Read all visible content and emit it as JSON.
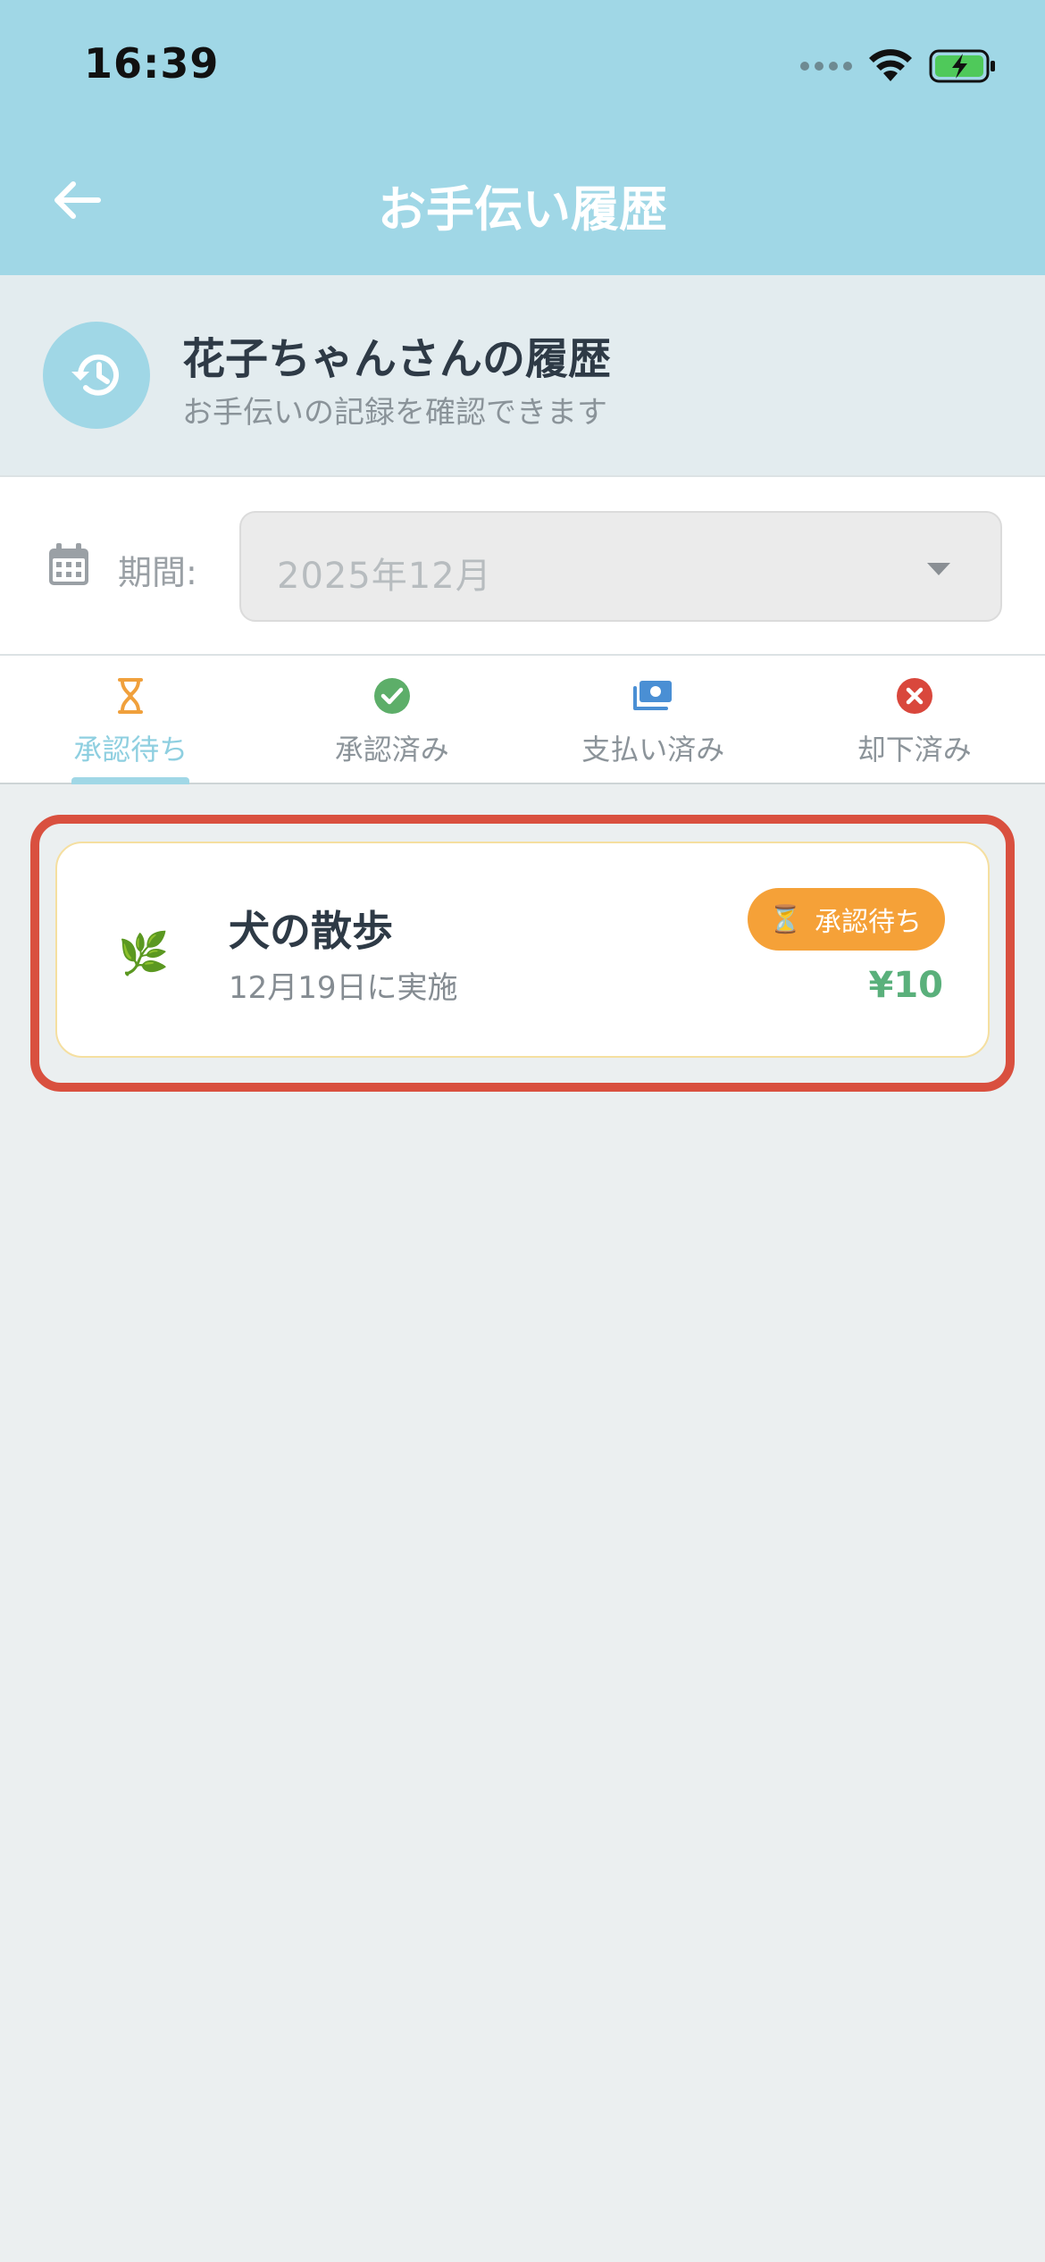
{
  "status_bar": {
    "time": "16:39"
  },
  "header": {
    "title": "お手伝い履歴"
  },
  "profile": {
    "title": "花子ちゃんさんの履歴",
    "subtitle": "お手伝いの記録を確認できます"
  },
  "period": {
    "label": "期間:",
    "value": "2025年12月"
  },
  "tabs": [
    {
      "label": "承認待ち",
      "icon": "hourglass-icon",
      "active": true,
      "color": "#F0A03C"
    },
    {
      "label": "承認済み",
      "icon": "check-circle-icon",
      "active": false,
      "color": "#5DAE69"
    },
    {
      "label": "支払い済み",
      "icon": "money-icon",
      "active": false,
      "color": "#4A8FD4"
    },
    {
      "label": "却下済み",
      "icon": "x-circle-icon",
      "active": false,
      "color": "#D9473C"
    }
  ],
  "cards": [
    {
      "emoji": "🌿",
      "title": "犬の散歩",
      "date": "12月19日に実施",
      "status_icon": "⏳",
      "status": "承認待ち",
      "amount": "¥10"
    }
  ],
  "colors": {
    "header_bg": "#A0D7E6",
    "badge": "#F5A138",
    "amount": "#5AB07B",
    "highlight": "#D9503F"
  }
}
